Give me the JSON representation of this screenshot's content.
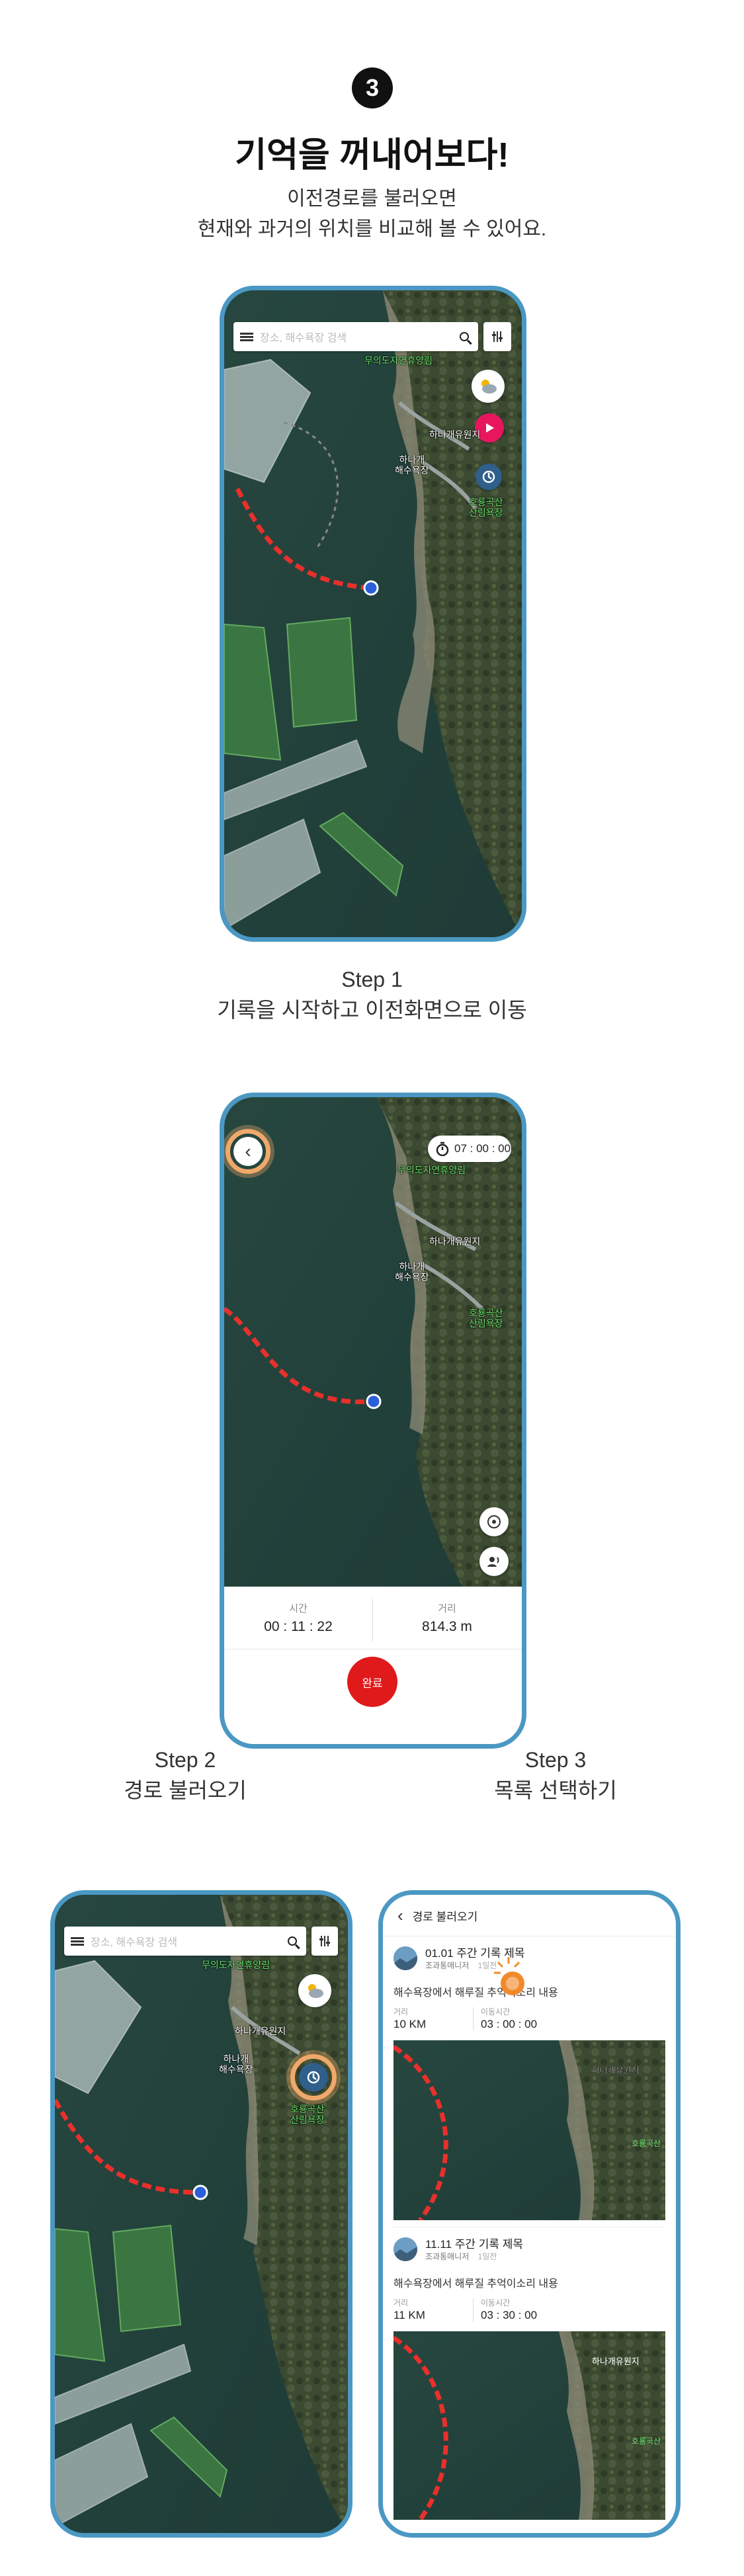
{
  "intro": {
    "step_number": "3",
    "title": "기억을 꺼내어보다!",
    "subtitle_line1": "이전경로를 불러오면",
    "subtitle_line2": "현재와 과거의 위치를 비교해 볼 수 있어요."
  },
  "steps": [
    {
      "label": "Step 1",
      "desc": "기록을 시작하고 이전화면으로 이동"
    },
    {
      "label": "Step 2",
      "desc": "경로 불러오기"
    },
    {
      "label": "Step 3",
      "desc": "목록 선택하기"
    }
  ],
  "map": {
    "search_placeholder": "장소, 해수욕장 검색",
    "labels": {
      "park": "무의도자연휴양림",
      "hanagae": "하나개유원지",
      "beach": "하나개\n해수욕장",
      "forest": "호룡곡산\n산림욕장"
    }
  },
  "recording": {
    "timer": "07 : 00 : 00",
    "time_label": "시간",
    "time_value": "00 : 11 : 22",
    "distance_label": "거리",
    "distance_value": "814.3 m",
    "end_button": "완료"
  },
  "route_list": {
    "header_title": "경로 불러오기",
    "items": [
      {
        "title": "01.01 주간 기록 제목",
        "user": "조과통매니저",
        "ago": "1일전",
        "desc": "해수욕장에서 해루질 추억이소리 내용",
        "distance_label": "거리",
        "distance_value": "10 KM",
        "time_label": "이동시간",
        "time_value": "03 : 00 : 00"
      },
      {
        "title": "11.11 주간 기록 제목",
        "user": "조과통매니저",
        "ago": "1일전",
        "desc": "해수욕장에서 해루질 추억이소리 내용",
        "distance_label": "거리",
        "distance_value": "11 KM",
        "time_label": "이동시간",
        "time_value": "03 : 30 : 00"
      }
    ]
  },
  "colors": {
    "phone_frame": "#4a98c3",
    "route": "#e8302b",
    "highlight": "#f0a86b",
    "end_button": "#e0191b",
    "water": "#24433e"
  }
}
